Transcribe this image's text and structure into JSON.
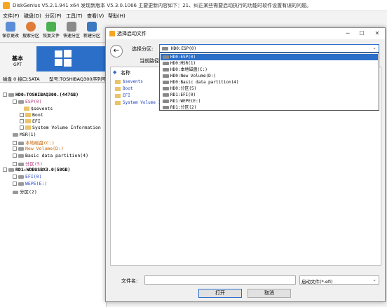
{
  "app": {
    "title": "DiskGenius V5.2.1.941 x64   发现新版本 V5.3.0.1066 主要更新内容如下：21、纠正某些需要启动执行的功能时软件设置有误的问题。",
    "menu": [
      "文件(F)",
      "磁盘(D)",
      "分区(P)",
      "工具(T)",
      "查看(V)",
      "帮助(H)"
    ],
    "toolbar": [
      "保存更改",
      "搜索分区",
      "恢复文件",
      "快速分区",
      "新建分区"
    ],
    "basic_label": "基本",
    "basic_sub": "GPT",
    "disk_info": [
      "磁盘 0 接口:SATA",
      "型号:TOSHIBAQ300",
      "序列号"
    ]
  },
  "tree": [
    {
      "text": "HD0:TOSHIBAQ300.(447GB)",
      "color": "#000"
    },
    {
      "text": "ESP(0)",
      "color": "#b0337a"
    },
    {
      "text": "$sevents",
      "color": "#000"
    },
    {
      "text": "Boot",
      "color": "#000"
    },
    {
      "text": "EFI",
      "color": "#000"
    },
    {
      "text": "System Volume Information",
      "color": "#000"
    },
    {
      "text": "MSR(1)",
      "color": "#000"
    },
    {
      "text": "本地磁盘(C:)",
      "color": "#c46200"
    },
    {
      "text": "New Volume(D:)",
      "color": "#c46200"
    },
    {
      "text": "Basic data partition(4)",
      "color": "#000"
    },
    {
      "text": "分区(5)",
      "color": "#b0337a"
    },
    {
      "text": "RD1:WDBUSBX3.0(58GB)",
      "color": "#000"
    },
    {
      "text": "EFI(0)",
      "color": "#1f3fbf"
    },
    {
      "text": "WEPE(E:)",
      "color": "#1f3fbf"
    },
    {
      "text": "分区(2)",
      "color": "#000"
    }
  ],
  "dialog": {
    "title": "选择启动文件",
    "select_label": "选择分区:",
    "current_path_label": "当前路径:",
    "selected_partition": "HD0:ESP(0)",
    "dropdown_options": [
      "HD0:ESP(0)",
      "HD0:MSR(1)",
      "HD0:本地磁盘(C:)",
      "HD0:New Volume(D:)",
      "HD0:Basic data partition(4)",
      "HD0:分区(5)",
      "RD1:EFI(0)",
      "RD1:WEPE(E:)",
      "RD1:分区(2)"
    ],
    "selected_index": 0,
    "column_name": "名称",
    "files": [
      "$sevents",
      "Boot",
      "EFI",
      "System Volume I..."
    ],
    "filename_label": "文件名:",
    "filename_value": "",
    "filetype_value": "启动文件(*.efi)",
    "open_label": "打开",
    "cancel_label": "取消"
  }
}
